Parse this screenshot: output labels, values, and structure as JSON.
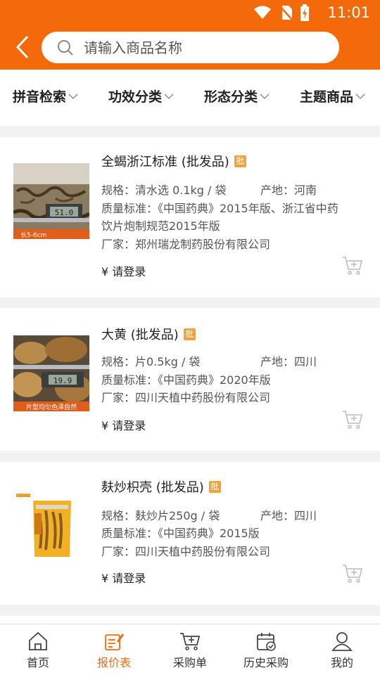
{
  "status": {
    "time": "11:01"
  },
  "search": {
    "placeholder": "请输入商品名称"
  },
  "filters": [
    {
      "label": "拼音检索"
    },
    {
      "label": "功效分类"
    },
    {
      "label": "形态分类"
    },
    {
      "label": "主题商品"
    }
  ],
  "products": [
    {
      "title": "全蝎浙江标准 (批发品)",
      "badge": "批",
      "spec": "规格：清水选 0.1kg / 袋",
      "origin": "产地：河南",
      "standard_line1": "质量标准：《中国药典》2015年版、浙江省中药",
      "standard_line2": "饮片炮制规范2015年版",
      "maker": "厂家：郑州瑞龙制药股份有限公司",
      "price": "¥ 请登录",
      "thumb_caption": "长5-6cm",
      "thumb_reading": "51.0"
    },
    {
      "title": "大黄 (批发品)",
      "badge": "批",
      "spec": "规格：片0.5kg / 袋",
      "origin": "产地：四川",
      "standard_line1": "质量标准：《中国药典》2020年版",
      "maker": "厂家：四川天植中药股份有限公司",
      "price": "¥ 请登录",
      "thumb_caption": "片型均匀色泽自然",
      "thumb_reading": "19.9"
    },
    {
      "title": "麸炒枳壳 (批发品)",
      "badge": "批",
      "spec": "规格：麸炒片250g / 袋",
      "origin": "产地：四川",
      "standard_line1": "质量标准：《中国药典》2015版",
      "maker": "厂家：四川天植中药股份有限公司",
      "price": "¥ 请登录"
    }
  ],
  "tabs": [
    {
      "label": "首页",
      "icon": "home-icon"
    },
    {
      "label": "报价表",
      "icon": "quote-icon"
    },
    {
      "label": "采购单",
      "icon": "cart-icon"
    },
    {
      "label": "历史采购",
      "icon": "history-icon"
    },
    {
      "label": "我的",
      "icon": "user-icon"
    }
  ],
  "colors": {
    "accent": "#f46a0b",
    "badge": "#f0a23c"
  }
}
